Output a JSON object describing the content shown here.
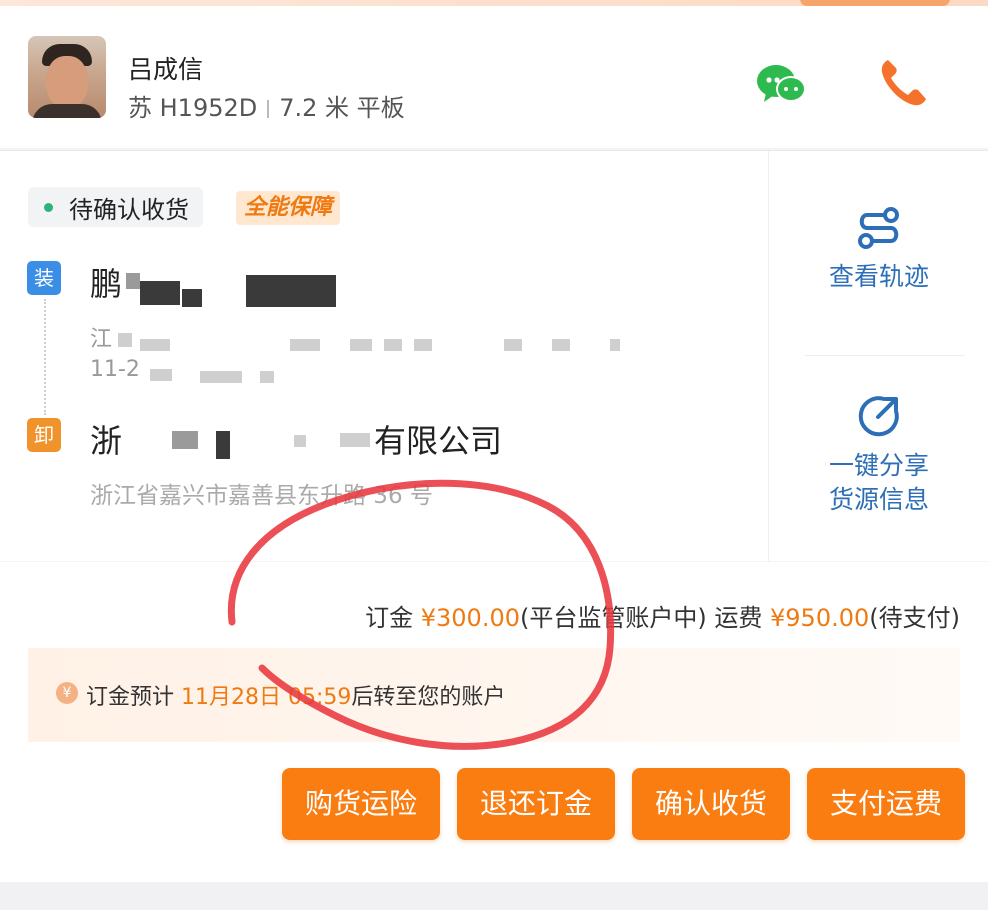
{
  "driver": {
    "name": "吕成信",
    "plate": "苏 H1952D",
    "vehicle": "7.2 米 平板",
    "wechat_icon": "wechat-icon",
    "phone_icon": "phone-icon"
  },
  "order": {
    "status": "待确认收货",
    "status_color": "#2db37a",
    "guarantee_badge": "全能保障",
    "load_tag": "装",
    "load_name": "鹏",
    "load_addr": "江",
    "load_time": "11-2",
    "unload_tag": "卸",
    "unload_name_prefix": "浙",
    "unload_name_suffix": "有限公司",
    "unload_addr": "浙江省嘉兴市嘉善县东升路 36 号"
  },
  "side": {
    "track_label": "查看轨迹",
    "share_line1": "一键分享",
    "share_line2": "货源信息"
  },
  "payment": {
    "deposit_label": "订金",
    "deposit_amount": "¥300.00",
    "deposit_status": "(平台监管账户中)",
    "freight_label": "运费",
    "freight_amount": "¥950.00",
    "freight_status": "(待支付)",
    "notice_prefix": "订金预计",
    "notice_time": "11月28日 05:59",
    "notice_suffix": "后转至您的账户",
    "accent_color": "#f07a12"
  },
  "actions": {
    "insurance": "购货运险",
    "refund": "退还订金",
    "confirm": "确认收货",
    "pay": "支付运费",
    "button_color": "#fa7d12"
  }
}
